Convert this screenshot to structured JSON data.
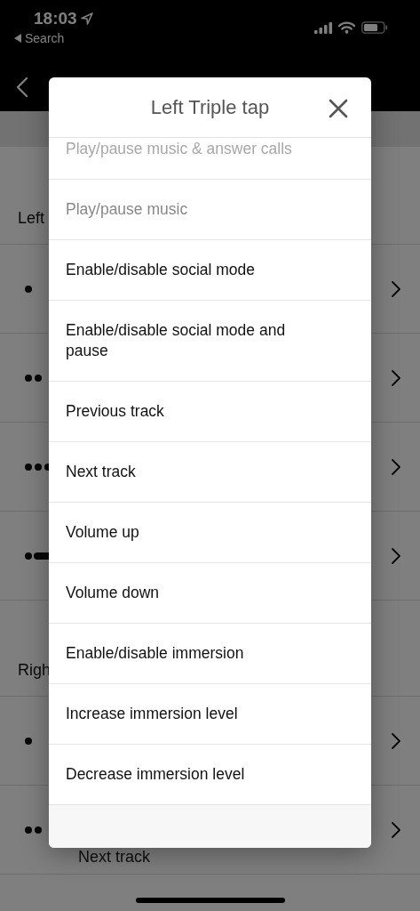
{
  "status_bar": {
    "time": "18:03",
    "back_label": "Search"
  },
  "page": {
    "sections": [
      {
        "label": "Left",
        "rows": [
          {
            "kind": "single"
          },
          {
            "kind": "double"
          },
          {
            "kind": "triple"
          },
          {
            "kind": "hold"
          }
        ]
      },
      {
        "label": "Righ",
        "rows": [
          {
            "kind": "single"
          },
          {
            "kind": "double",
            "subtitle": "Next track"
          }
        ]
      }
    ]
  },
  "modal": {
    "title": "Left Triple tap",
    "options": [
      {
        "label": "Play/pause music & answer calls",
        "disabled": true,
        "scrolled": true
      },
      {
        "label": "Play/pause music",
        "disabled": true,
        "scrolled": false
      },
      {
        "label": "Enable/disable social mode",
        "disabled": false,
        "scrolled": false
      },
      {
        "label": "Enable/disable social mode and pause",
        "disabled": false,
        "scrolled": false
      },
      {
        "label": "Previous track",
        "disabled": false,
        "scrolled": false
      },
      {
        "label": "Next track",
        "disabled": false,
        "scrolled": false
      },
      {
        "label": "Volume up",
        "disabled": false,
        "scrolled": false
      },
      {
        "label": "Volume down",
        "disabled": false,
        "scrolled": false
      },
      {
        "label": "Enable/disable immersion",
        "disabled": false,
        "scrolled": false
      },
      {
        "label": "Increase immersion level",
        "disabled": false,
        "scrolled": false
      },
      {
        "label": "Decrease immersion level",
        "disabled": false,
        "scrolled": false
      }
    ]
  }
}
